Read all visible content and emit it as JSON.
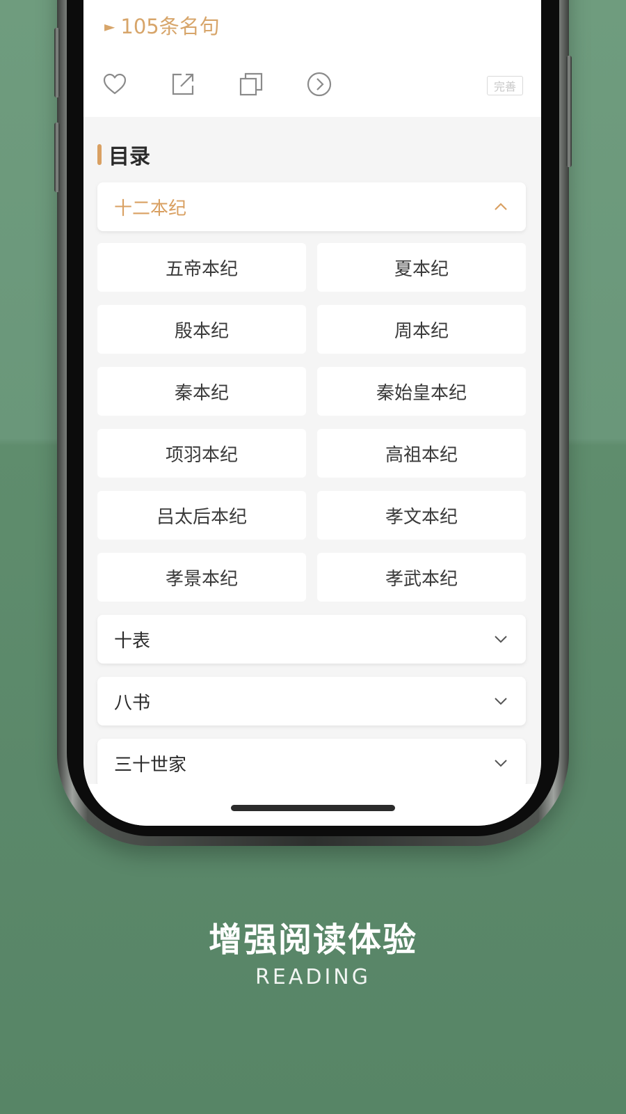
{
  "header": {
    "quotes_link": "105条名句",
    "improve_label": "完善"
  },
  "toolbar": {
    "icons": [
      "heart-icon",
      "share-icon",
      "copy-icon",
      "next-circle-icon"
    ]
  },
  "toc": {
    "title": "目录",
    "groups": [
      {
        "label": "十二本纪",
        "expanded": true,
        "chapters": [
          "五帝本纪",
          "夏本纪",
          "殷本纪",
          "周本纪",
          "秦本纪",
          "秦始皇本纪",
          "项羽本纪",
          "高祖本纪",
          "吕太后本纪",
          "孝文本纪",
          "孝景本纪",
          "孝武本纪"
        ]
      },
      {
        "label": "十表",
        "expanded": false
      },
      {
        "label": "八书",
        "expanded": false
      },
      {
        "label": "三十世家",
        "expanded": false
      }
    ]
  },
  "promo": {
    "title": "增强阅读体验",
    "subtitle": "READING"
  },
  "colors": {
    "accent": "#d9a062",
    "background_green": "#5b886a",
    "panel": "#f5f5f5"
  }
}
